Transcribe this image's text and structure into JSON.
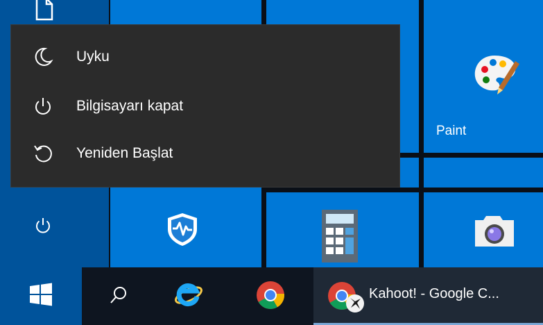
{
  "power_menu": {
    "items": [
      {
        "label": "Uyku",
        "icon": "moon-icon"
      },
      {
        "label": "Bilgisayarı kapat",
        "icon": "power-icon"
      },
      {
        "label": "Yeniden Başlat",
        "icon": "restart-icon"
      }
    ]
  },
  "tiles": {
    "paint_label": "Paint"
  },
  "taskbar": {
    "active_window_title": "Kahoot! - Google C..."
  },
  "colors": {
    "tile_blue": "#0078d7",
    "dark_blue": "#00539b",
    "flyout_bg": "#2b2b2b",
    "taskbar_bg": "#0e1520"
  }
}
